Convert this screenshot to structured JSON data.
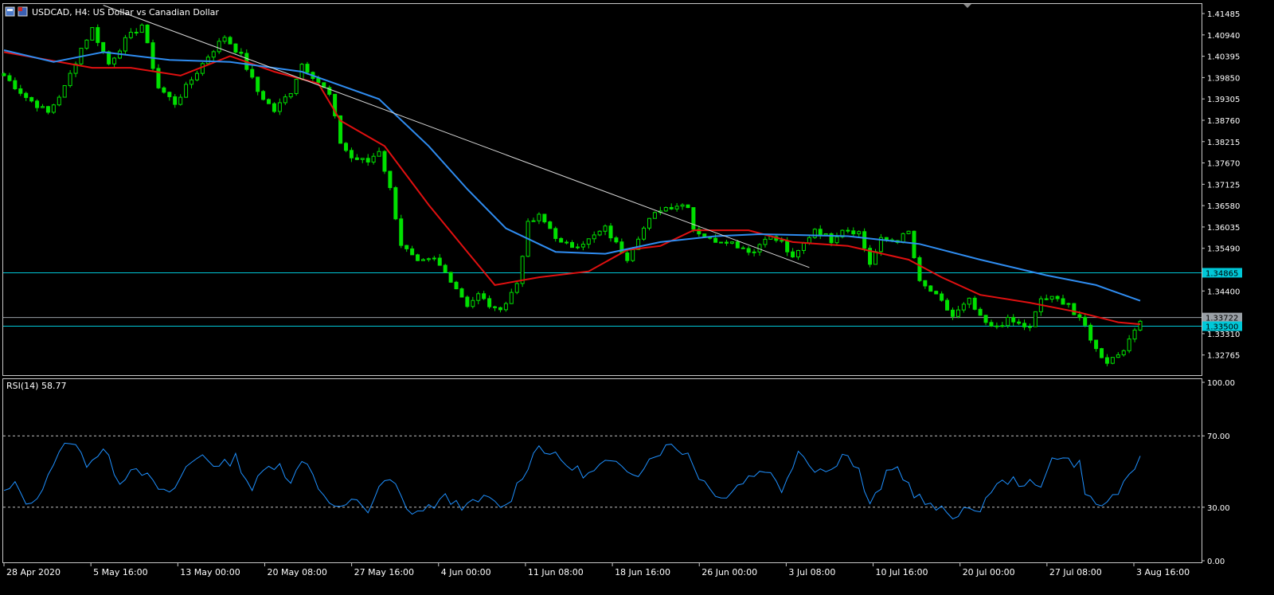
{
  "symbol_title": "USDCAD, H4:  US Dollar vs Canadian Dollar",
  "rsi_label": "RSI(14) 58.77",
  "colors": {
    "background": "#000000",
    "candles": "#00e000",
    "ma_fast": "#e01010",
    "ma_slow": "#2f8cf0",
    "trendline": "#d8d8d8",
    "level_lines": "#00c8d8",
    "rsi_line": "#1e90ff",
    "axis": "#ffffff"
  },
  "chart_data": [
    {
      "type": "candlestick",
      "symbol": "USDCAD",
      "timeframe": "H4",
      "ylim": [
        1.3225,
        1.4175
      ],
      "y_ticks": [
        "1.41485",
        "1.40940",
        "1.40395",
        "1.39850",
        "1.39305",
        "1.38760",
        "1.38215",
        "1.37670",
        "1.37125",
        "1.36580",
        "1.36035",
        "1.35490",
        "1.34400",
        "1.33310",
        "1.32765"
      ],
      "x_ticks": [
        "28 Apr 2020",
        "5 May 16:00",
        "13 May 00:00",
        "20 May 08:00",
        "27 May 16:00",
        "4 Jun 00:00",
        "11 Jun 08:00",
        "18 Jun 16:00",
        "26 Jun 00:00",
        "3 Jul 08:00",
        "10 Jul 16:00",
        "20 Jul 00:00",
        "27 Jul 08:00",
        "3 Aug 16:00"
      ],
      "close_path": [
        [
          0,
          1.399
        ],
        [
          4,
          1.3935
        ],
        [
          8,
          1.3895
        ],
        [
          11,
          1.396
        ],
        [
          14,
          1.406
        ],
        [
          16,
          1.411
        ],
        [
          19,
          1.402
        ],
        [
          22,
          1.408
        ],
        [
          25,
          1.412
        ],
        [
          28,
          1.396
        ],
        [
          31,
          1.392
        ],
        [
          34,
          1.398
        ],
        [
          37,
          1.404
        ],
        [
          40,
          1.409
        ],
        [
          43,
          1.404
        ],
        [
          46,
          1.395
        ],
        [
          49,
          1.39
        ],
        [
          52,
          1.395
        ],
        [
          54,
          1.402
        ],
        [
          56,
          1.399
        ],
        [
          59,
          1.394
        ],
        [
          61,
          1.382
        ],
        [
          63,
          1.378
        ],
        [
          66,
          1.377
        ],
        [
          68,
          1.38
        ],
        [
          70,
          1.37
        ],
        [
          72,
          1.356
        ],
        [
          75,
          1.351
        ],
        [
          78,
          1.352
        ],
        [
          81,
          1.347
        ],
        [
          84,
          1.3405
        ],
        [
          86,
          1.343
        ],
        [
          89,
          1.339
        ],
        [
          91,
          1.341
        ],
        [
          93,
          1.346
        ],
        [
          95,
          1.361
        ],
        [
          97,
          1.363
        ],
        [
          99,
          1.36
        ],
        [
          101,
          1.356
        ],
        [
          103,
          1.3555
        ],
        [
          106,
          1.357
        ],
        [
          109,
          1.36
        ],
        [
          111,
          1.356
        ],
        [
          113,
          1.3525
        ],
        [
          115,
          1.358
        ],
        [
          117,
          1.362
        ],
        [
          119,
          1.365
        ],
        [
          122,
          1.366
        ],
        [
          124,
          1.366
        ],
        [
          125,
          1.36
        ],
        [
          128,
          1.357
        ],
        [
          131,
          1.357
        ],
        [
          134,
          1.355
        ],
        [
          136,
          1.354
        ],
        [
          138,
          1.358
        ],
        [
          141,
          1.3565
        ],
        [
          143,
          1.352
        ],
        [
          145,
          1.356
        ],
        [
          147,
          1.36
        ],
        [
          150,
          1.357
        ],
        [
          152,
          1.36
        ],
        [
          155,
          1.359
        ],
        [
          157,
          1.351
        ],
        [
          159,
          1.357
        ],
        [
          162,
          1.357
        ],
        [
          164,
          1.359
        ],
        [
          166,
          1.346
        ],
        [
          168,
          1.344
        ],
        [
          170,
          1.341
        ],
        [
          172,
          1.3375
        ],
        [
          175,
          1.3415
        ],
        [
          177,
          1.337
        ],
        [
          179,
          1.3345
        ],
        [
          182,
          1.3365
        ],
        [
          184,
          1.3355
        ],
        [
          186,
          1.3345
        ],
        [
          188,
          1.342
        ],
        [
          190,
          1.342
        ],
        [
          193,
          1.341
        ],
        [
          194,
          1.338
        ],
        [
          196,
          1.335
        ],
        [
          198,
          1.329
        ],
        [
          200,
          1.326
        ],
        [
          202,
          1.328
        ],
        [
          204,
          1.331
        ],
        [
          206,
          1.337
        ]
      ],
      "candle_count": 207,
      "series": [
        {
          "name": "",
          "role": "ma_fast",
          "color": "#e01010",
          "points": [
            [
              0,
              1.405
            ],
            [
              16,
              1.401
            ],
            [
              23,
              1.401
            ],
            [
              32,
              1.399
            ],
            [
              41,
              1.404
            ],
            [
              49,
              1.4
            ],
            [
              57,
              1.397
            ],
            [
              61,
              1.3875
            ],
            [
              69,
              1.381
            ],
            [
              77,
              1.366
            ],
            [
              84,
              1.354
            ],
            [
              89,
              1.3455
            ],
            [
              97,
              1.3475
            ],
            [
              106,
              1.349
            ],
            [
              113,
              1.3545
            ],
            [
              119,
              1.3555
            ],
            [
              125,
              1.3595
            ],
            [
              135,
              1.3595
            ],
            [
              143,
              1.3565
            ],
            [
              153,
              1.3555
            ],
            [
              164,
              1.352
            ],
            [
              170,
              1.3475
            ],
            [
              177,
              1.343
            ],
            [
              186,
              1.341
            ],
            [
              195,
              1.3385
            ],
            [
              202,
              1.336
            ],
            [
              206,
              1.3355
            ]
          ]
        },
        {
          "name": "",
          "role": "ma_slow",
          "color": "#2f8cf0",
          "points": [
            [
              0,
              1.4055
            ],
            [
              9,
              1.4025
            ],
            [
              18,
              1.405
            ],
            [
              30,
              1.403
            ],
            [
              41,
              1.4025
            ],
            [
              54,
              1.4
            ],
            [
              68,
              1.393
            ],
            [
              77,
              1.381
            ],
            [
              84,
              1.37
            ],
            [
              91,
              1.36
            ],
            [
              100,
              1.354
            ],
            [
              109,
              1.3535
            ],
            [
              119,
              1.3565
            ],
            [
              129,
              1.358
            ],
            [
              137,
              1.3585
            ],
            [
              153,
              1.358
            ],
            [
              166,
              1.356
            ],
            [
              177,
              1.352
            ],
            [
              189,
              1.348
            ],
            [
              198,
              1.3455
            ],
            [
              206,
              1.3415
            ]
          ]
        },
        {
          "name": "",
          "role": "trendline",
          "color": "#d8d8d8",
          "points": [
            [
              18,
              1.417
            ],
            [
              146,
              1.35
            ]
          ]
        }
      ],
      "levels": [
        {
          "value": 1.34865,
          "label": "1.34865",
          "color": "#00c8d8"
        },
        {
          "value": 1.33722,
          "label": "1.33722",
          "color": "#9aa0a6"
        },
        {
          "value": 1.335,
          "label": "1.33500",
          "color": "#00c8d8"
        }
      ],
      "grid": false
    },
    {
      "type": "line",
      "name": "RSI(14)",
      "current_value": 58.77,
      "ylim": [
        0,
        100
      ],
      "y_ticks": [
        "100.00",
        "70.00",
        "30.00",
        "0.00"
      ],
      "reference_levels": [
        70,
        30
      ],
      "series": [
        {
          "name": "RSI(14)",
          "color": "#1e90ff",
          "points": [
            [
              0,
              38
            ],
            [
              2,
              42
            ],
            [
              5,
              30
            ],
            [
              9,
              55
            ],
            [
              12,
              68
            ],
            [
              15,
              55
            ],
            [
              18,
              62
            ],
            [
              21,
              45
            ],
            [
              24,
              54
            ],
            [
              27,
              43
            ],
            [
              30,
              36
            ],
            [
              33,
              52
            ],
            [
              36,
              60
            ],
            [
              39,
              52
            ],
            [
              42,
              58
            ],
            [
              45,
              40
            ],
            [
              47,
              50
            ],
            [
              50,
              56
            ],
            [
              52,
              42
            ],
            [
              54,
              58
            ],
            [
              56,
              50
            ],
            [
              58,
              35
            ],
            [
              61,
              28
            ],
            [
              64,
              35
            ],
            [
              66,
              28
            ],
            [
              69,
              45
            ],
            [
              71,
              42
            ],
            [
              73,
              28
            ],
            [
              76,
              28
            ],
            [
              80,
              35
            ],
            [
              84,
              30
            ],
            [
              87,
              35
            ],
            [
              91,
              30
            ],
            [
              94,
              48
            ],
            [
              97,
              65
            ],
            [
              100,
              58
            ],
            [
              103,
              52
            ],
            [
              106,
              48
            ],
            [
              109,
              55
            ],
            [
              112,
              52
            ],
            [
              115,
              50
            ],
            [
              118,
              60
            ],
            [
              121,
              65
            ],
            [
              124,
              60
            ],
            [
              126,
              48
            ],
            [
              128,
              40
            ],
            [
              131,
              36
            ],
            [
              134,
              45
            ],
            [
              138,
              52
            ],
            [
              141,
              40
            ],
            [
              144,
              62
            ],
            [
              147,
              52
            ],
            [
              150,
              50
            ],
            [
              152,
              62
            ],
            [
              155,
              50
            ],
            [
              157,
              30
            ],
            [
              160,
              48
            ],
            [
              162,
              52
            ],
            [
              165,
              38
            ],
            [
              168,
              30
            ],
            [
              170,
              28
            ],
            [
              172,
              25
            ],
            [
              174,
              30
            ],
            [
              176,
              25
            ],
            [
              179,
              40
            ],
            [
              182,
              45
            ],
            [
              185,
              44
            ],
            [
              188,
              40
            ],
            [
              190,
              60
            ],
            [
              193,
              56
            ],
            [
              195,
              54
            ],
            [
              196,
              40
            ],
            [
              198,
              30
            ],
            [
              200,
              33
            ],
            [
              203,
              42
            ],
            [
              205,
              49
            ],
            [
              206,
              58.77
            ]
          ]
        }
      ]
    }
  ]
}
